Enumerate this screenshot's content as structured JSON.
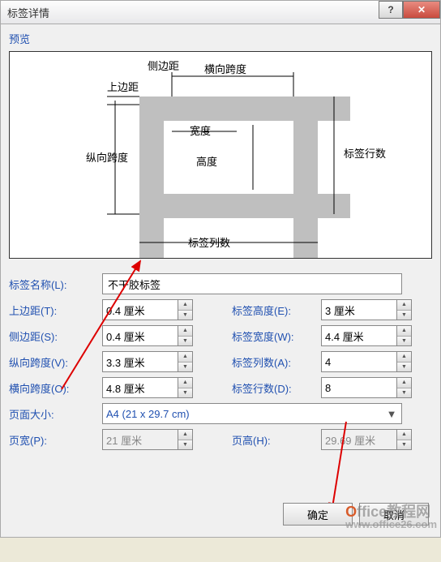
{
  "titlebar": {
    "title": "标签详情",
    "help": "?",
    "close": "✕"
  },
  "preview": {
    "label": "预览",
    "diagram": {
      "side_margin": "侧边距",
      "top_margin": "上边距",
      "h_span": "横向跨度",
      "v_span": "纵向跨度",
      "width": "宽度",
      "height": "高度",
      "rows": "标签行数",
      "cols": "标签列数"
    }
  },
  "fields": {
    "label_name": {
      "label": "标签名称(L):",
      "value": "不干胶标签"
    },
    "top_margin": {
      "label": "上边距(T):",
      "value": "0.4 厘米"
    },
    "side_margin": {
      "label": "侧边距(S):",
      "value": "0.4 厘米"
    },
    "v_span": {
      "label": "纵向跨度(V):",
      "value": "3.3 厘米"
    },
    "h_span": {
      "label": "横向跨度(O):",
      "value": "4.8 厘米"
    },
    "label_height": {
      "label": "标签高度(E):",
      "value": "3 厘米"
    },
    "label_width": {
      "label": "标签宽度(W):",
      "value": "4.4 厘米"
    },
    "col_count": {
      "label": "标签列数(A):",
      "value": "4"
    },
    "row_count": {
      "label": "标签行数(D):",
      "value": "8"
    },
    "page_size": {
      "label": "页面大小:",
      "value": "A4 (21 x 29.7 cm)"
    },
    "page_width": {
      "label": "页宽(P):",
      "value": "21 厘米"
    },
    "page_height": {
      "label": "页高(H):",
      "value": "29.69 厘米"
    }
  },
  "buttons": {
    "ok": "确定",
    "cancel": "取消"
  },
  "watermark": {
    "brand": "Office教程网",
    "url": "www.office26.com"
  }
}
